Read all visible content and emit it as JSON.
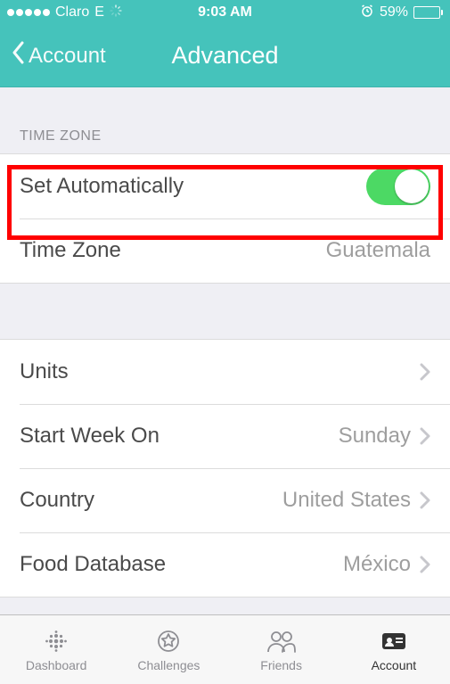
{
  "status": {
    "carrier": "Claro",
    "network": "E",
    "time": "9:03 AM",
    "battery_pct": "59%",
    "battery_fill_pct": 59
  },
  "nav": {
    "back_label": "Account",
    "title": "Advanced"
  },
  "sections": {
    "timezone_header": "TIME ZONE",
    "set_auto_label": "Set Automatically",
    "set_auto_on": true,
    "timezone_label": "Time Zone",
    "timezone_value": "Guatemala",
    "units_label": "Units",
    "startweek_label": "Start Week On",
    "startweek_value": "Sunday",
    "country_label": "Country",
    "country_value": "United States",
    "fooddb_label": "Food Database",
    "fooddb_value": "México"
  },
  "tabs": {
    "dashboard": "Dashboard",
    "challenges": "Challenges",
    "friends": "Friends",
    "account": "Account"
  },
  "highlight_row_index": 0
}
